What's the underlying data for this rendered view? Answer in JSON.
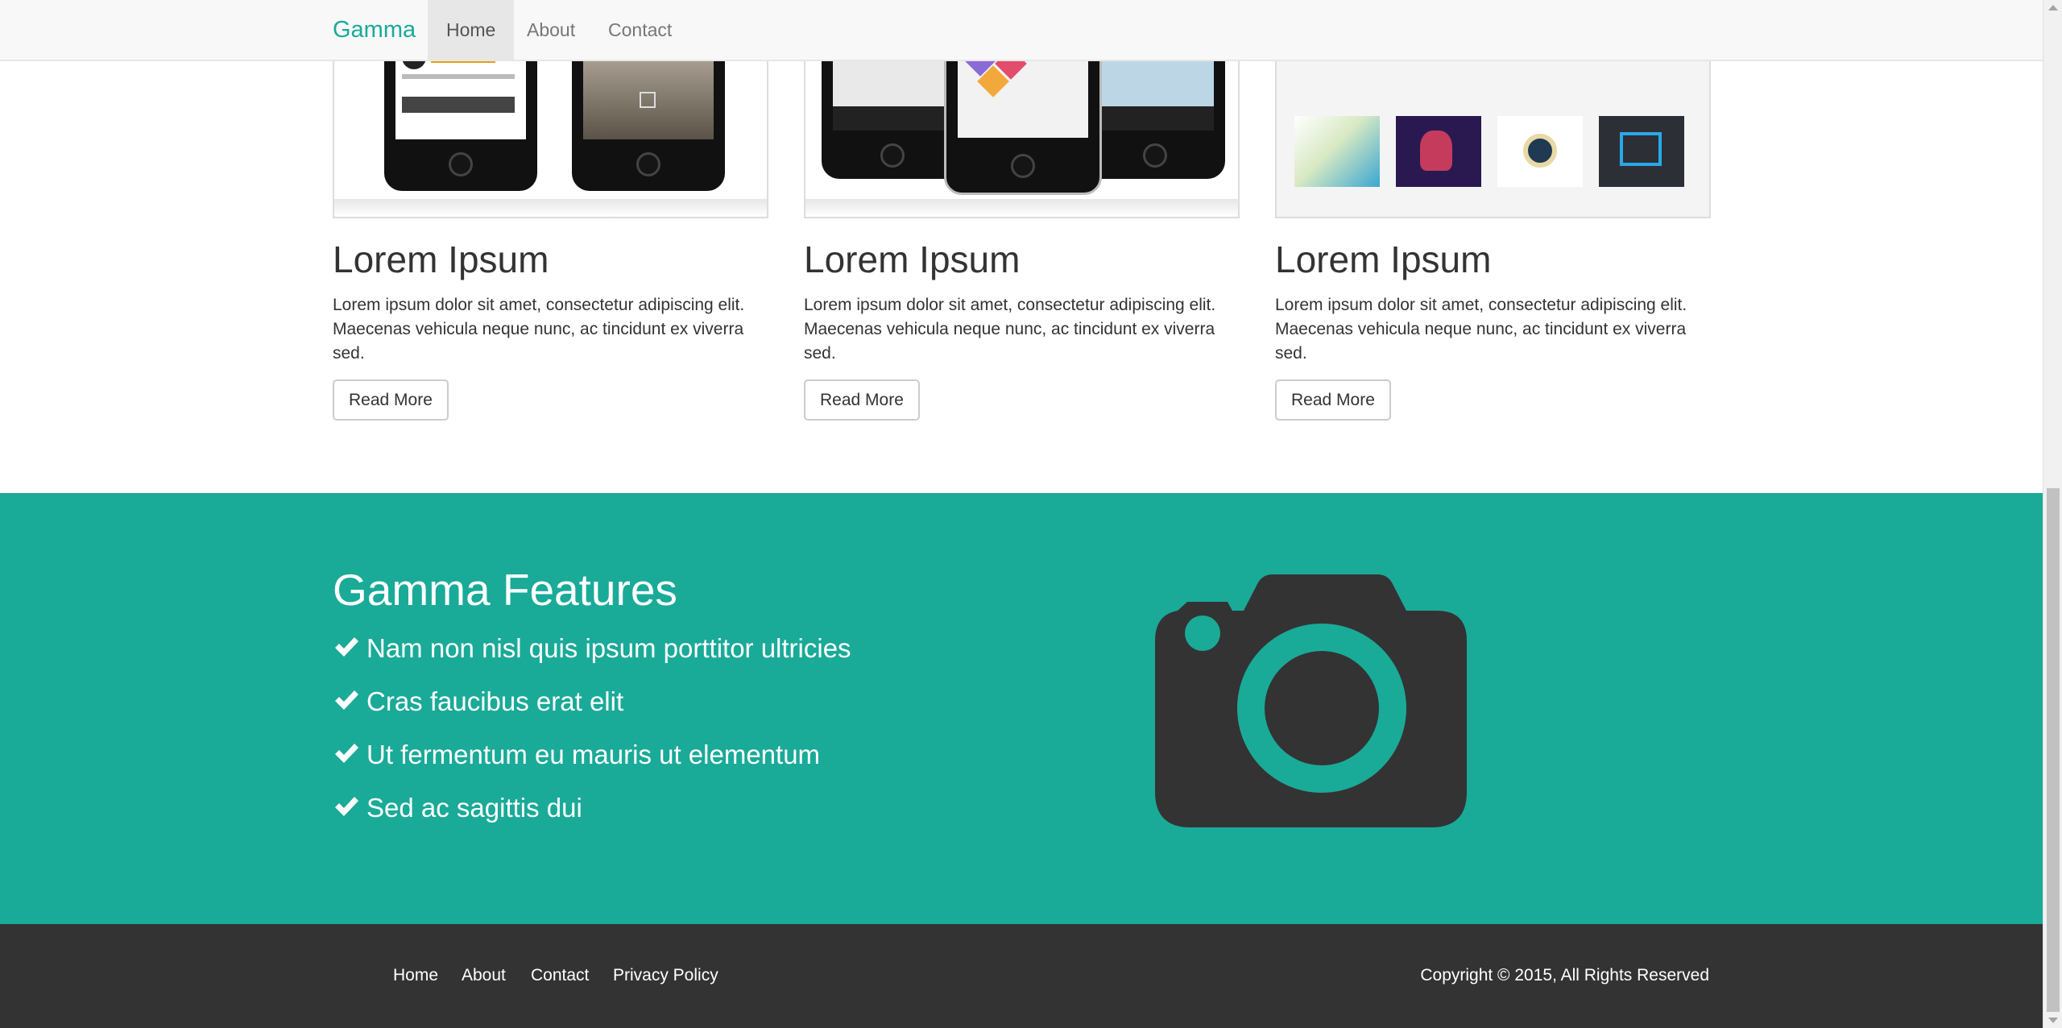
{
  "navbar": {
    "brand": "Gamma",
    "items": [
      {
        "label": "Home",
        "active": true
      },
      {
        "label": "About",
        "active": false
      },
      {
        "label": "Contact",
        "active": false
      }
    ]
  },
  "cards": [
    {
      "title": "Lorem Ipsum",
      "text": "Lorem ipsum dolor sit amet, consectetur adipiscing elit. Maecenas vehicula neque nunc, ac tincidunt ex viverra sed.",
      "button": "Read More"
    },
    {
      "title": "Lorem Ipsum",
      "text": "Lorem ipsum dolor sit amet, consectetur adipiscing elit. Maecenas vehicula neque nunc, ac tincidunt ex viverra sed.",
      "button": "Read More"
    },
    {
      "title": "Lorem Ipsum",
      "text": "Lorem ipsum dolor sit amet, consectetur adipiscing elit. Maecenas vehicula neque nunc, ac tincidunt ex viverra sed.",
      "button": "Read More"
    }
  ],
  "features": {
    "title": "Gamma Features",
    "items": [
      "Nam non nisl quis ipsum porttitor ultricies",
      "Cras faucibus erat elit",
      "Ut fermentum eu mauris ut elementum",
      "Sed ac sagittis dui"
    ],
    "icon": "camera-icon"
  },
  "footer": {
    "links": [
      "Home",
      "About",
      "Contact",
      "Privacy Policy"
    ],
    "copyright": "Copyright © 2015, All Rights Reserved"
  },
  "colors": {
    "accent": "#1aaa98",
    "footer": "#333333",
    "navbar": "#f8f8f8"
  }
}
